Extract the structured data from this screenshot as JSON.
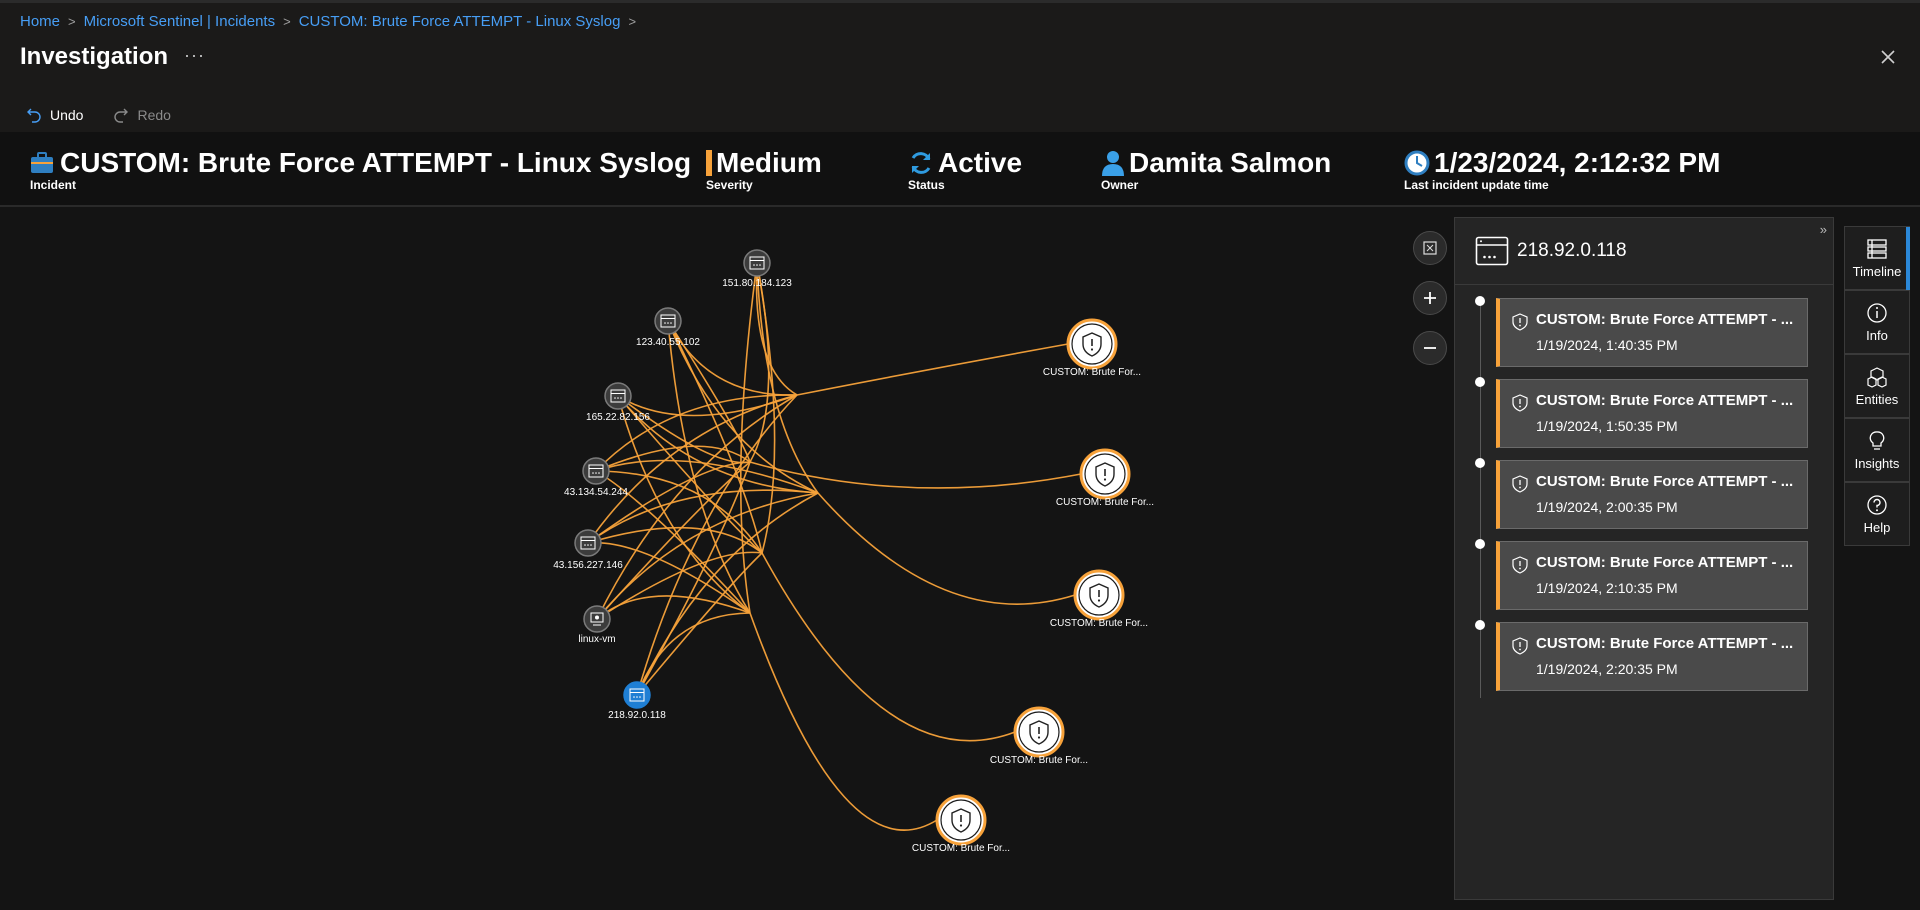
{
  "breadcrumb": {
    "items": [
      "Home",
      "Microsoft Sentinel | Incidents",
      "CUSTOM: Brute Force ATTEMPT - Linux Syslog"
    ]
  },
  "page": {
    "title": "Investigation",
    "more": "···"
  },
  "toolbar": {
    "undo_label": "Undo",
    "redo_label": "Redo"
  },
  "incident": {
    "title": "CUSTOM: Brute Force ATTEMPT - Linux Syslog",
    "title_label": "Incident",
    "severity": "Medium",
    "severity_label": "Severity",
    "status": "Active",
    "status_label": "Status",
    "owner": "Damita Salmon",
    "owner_label": "Owner",
    "updated": "1/23/2024, 2:12:32 PM",
    "updated_label": "Last incident update time"
  },
  "graph": {
    "entity_nodes": [
      {
        "label": "151.80.184.123",
        "icon": "server-icon"
      },
      {
        "label": "123.40.55.102",
        "icon": "server-icon"
      },
      {
        "label": "165.22.82.156",
        "icon": "server-icon"
      },
      {
        "label": "43.134.54.244",
        "icon": "server-icon"
      },
      {
        "label": "43.156.227.146",
        "icon": "server-icon"
      },
      {
        "label": "linux-vm",
        "icon": "computer-icon"
      },
      {
        "label": "218.92.0.118",
        "icon": "server-icon",
        "selected": true
      }
    ],
    "alert_nodes": [
      {
        "label": "CUSTOM: Brute For..."
      },
      {
        "label": "CUSTOM: Brute For..."
      },
      {
        "label": "CUSTOM: Brute For..."
      },
      {
        "label": "CUSTOM: Brute For..."
      },
      {
        "label": "CUSTOM: Brute For..."
      }
    ],
    "colors": {
      "edge": "#f7a23a",
      "selected": "#1f7fd4",
      "alert_ring": "#f7a23a"
    }
  },
  "panel": {
    "title": "218.92.0.118",
    "collapse": "»",
    "timeline": [
      {
        "title": "CUSTOM: Brute Force ATTEMPT - ...",
        "time": "1/19/2024, 1:40:35 PM"
      },
      {
        "title": "CUSTOM: Brute Force ATTEMPT - ...",
        "time": "1/19/2024, 1:50:35 PM"
      },
      {
        "title": "CUSTOM: Brute Force ATTEMPT - ...",
        "time": "1/19/2024, 2:00:35 PM"
      },
      {
        "title": "CUSTOM: Brute Force ATTEMPT - ...",
        "time": "1/19/2024, 2:10:35 PM"
      },
      {
        "title": "CUSTOM: Brute Force ATTEMPT - ...",
        "time": "1/19/2024, 2:20:35 PM"
      }
    ]
  },
  "side_tabs": [
    {
      "label": "Timeline",
      "icon": "timeline-icon",
      "active": true
    },
    {
      "label": "Info",
      "icon": "info-icon"
    },
    {
      "label": "Entities",
      "icon": "entities-icon"
    },
    {
      "label": "Insights",
      "icon": "lightbulb-icon"
    },
    {
      "label": "Help",
      "icon": "help-icon"
    }
  ]
}
